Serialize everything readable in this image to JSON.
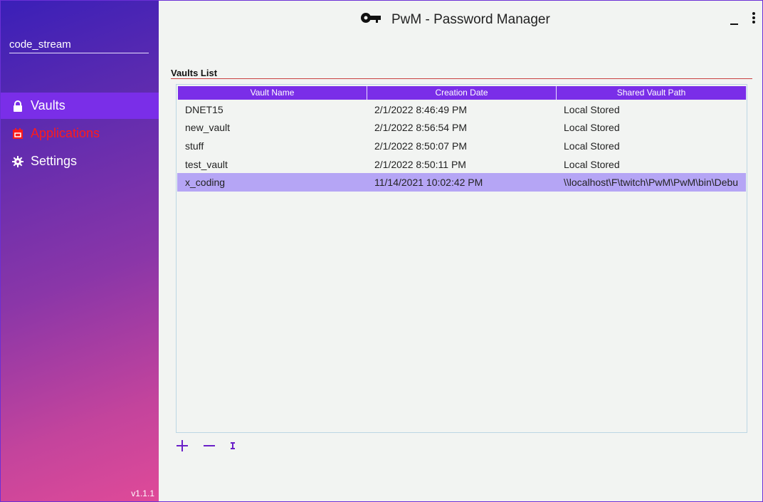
{
  "app": {
    "title": "PwM - Password Manager",
    "version": "v1.1.1"
  },
  "sidebar": {
    "username": "code_stream",
    "items": [
      {
        "label": "Vaults",
        "icon": "lock-icon"
      },
      {
        "label": "Applications",
        "icon": "calendar-icon"
      },
      {
        "label": "Settings",
        "icon": "gear-icon"
      }
    ]
  },
  "colors": {
    "accent": "#7a2ee8",
    "selected_row": "#b5a5f5",
    "alert": "#ff1a1a"
  },
  "vaults": {
    "section_title": "Vaults List",
    "columns": [
      "Vault Name",
      "Creation Date",
      "Shared Vault Path"
    ],
    "rows": [
      [
        "DNET15",
        "2/1/2022 8:46:49 PM",
        "Local Stored"
      ],
      [
        "new_vault",
        "2/1/2022 8:56:54 PM",
        "Local Stored"
      ],
      [
        "stuff",
        "2/1/2022 8:50:07 PM",
        "Local Stored"
      ],
      [
        "test_vault",
        "2/1/2022 8:50:11 PM",
        "Local Stored"
      ],
      [
        "x_coding",
        "11/14/2021 10:02:42 PM",
        "\\\\localhost\\F\\twitch\\PwM\\PwM\\bin\\Debu"
      ]
    ]
  }
}
